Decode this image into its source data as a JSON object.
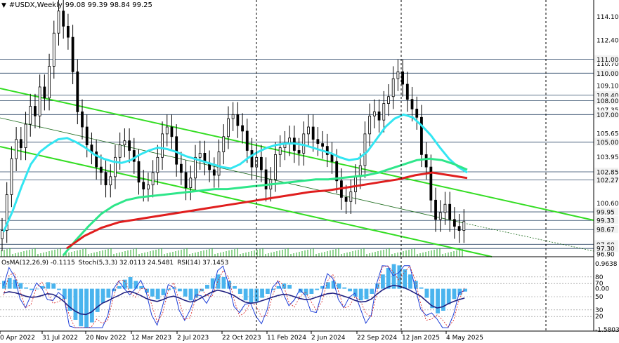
{
  "header": {
    "symbol": "#USDX,Weekly",
    "ohlc": "99.08 99.39 98.84 99.25"
  },
  "osma_header": {
    "osma": "OsMA(12,26,9) -0.1115",
    "stoch": "Stoch(5,3,3) 32.0113 24.5481",
    "rsi": "RSI(14) 37.1453"
  },
  "colors": {
    "ema_short": "#33e6f2",
    "ema_mid": "#2ee68a",
    "ema_long": "#e01e1e",
    "channel": "#33dd22",
    "candle": "#000000",
    "level_line": "#2b4766",
    "histogram": "#4ab4ee",
    "stoch_main": "#1f3fd8",
    "stoch_signal": "#d81f1f",
    "rsi": "#202080",
    "volume": "#22aa22"
  },
  "chart_data": [
    {
      "type": "candlestick",
      "timeframe": "Weekly",
      "x_ticks": [
        "0 Apr 2022",
        "31 Jul 2022",
        "20 Nov 2022",
        "12 Mar 2023",
        "2 Jul 2023",
        "22 Oct 2023",
        "11 Feb 2024",
        "2 Jun 2024",
        "22 Sep 2024",
        "12 Jan 2025",
        "4 May 2025"
      ],
      "y_ticks": [
        114.1,
        112.4,
        110.7,
        109.1,
        107.35,
        105.65,
        103.95,
        102.27,
        100.6,
        99.33,
        98.67,
        96.9
      ],
      "level_labels": [
        111.0,
        110.0,
        108.4,
        108.0,
        107.0,
        105.0,
        102.85,
        102.27,
        99.95,
        99.33,
        98.67,
        97.6,
        97.3
      ],
      "ylim": [
        96.7,
        115.3
      ],
      "close_series": [
        98.6,
        101.2,
        103.8,
        105.2,
        104.6,
        106.3,
        107.6,
        106.9,
        109.0,
        108.2,
        110.5,
        112.9,
        114.5,
        113.4,
        112.6,
        110.1,
        107.2,
        106.1,
        104.8,
        104.3,
        103.2,
        102.8,
        101.9,
        102.5,
        103.9,
        104.8,
        105.1,
        104.4,
        103.6,
        102.1,
        101.6,
        101.9,
        102.8,
        103.9,
        105.6,
        106.1,
        105.4,
        103.4,
        102.8,
        101.7,
        102.4,
        103.9,
        104.2,
        103.5,
        103.0,
        102.6,
        104.3,
        105.4,
        106.7,
        107.0,
        106.2,
        105.8,
        104.4,
        103.2,
        103.9,
        103.0,
        101.6,
        102.3,
        104.1,
        104.6,
        104.9,
        105.3,
        104.4,
        104.2,
        105.6,
        106.1,
        105.2,
        104.9,
        104.7,
        104.1,
        103.6,
        102.2,
        101.0,
        100.7,
        101.4,
        102.5,
        103.3,
        105.6,
        106.9,
        107.2,
        106.6,
        107.8,
        108.3,
        109.6,
        110.1,
        109.2,
        108.1,
        107.4,
        106.8,
        104.1,
        103.2,
        100.8,
        99.4,
        99.9,
        100.5,
        99.4,
        98.9,
        98.6,
        99.25
      ],
      "series": [
        {
          "name": "EMA short",
          "values": [
            98.5,
            100.0,
            101.8,
            103.4,
            104.3,
            104.8,
            105.2,
            105.3,
            105.0,
            104.6,
            104.1,
            103.8,
            103.6,
            103.5,
            103.7,
            104.1,
            104.4,
            104.6,
            104.5,
            104.3,
            104.0,
            103.8,
            103.6,
            103.4,
            103.2,
            103.1,
            103.4,
            103.9,
            104.3,
            104.6,
            104.8,
            104.9,
            104.9,
            104.8,
            104.6,
            104.4,
            104.2,
            103.9,
            103.7,
            103.8,
            104.3,
            105.2,
            106.1,
            106.7,
            107.0,
            106.8,
            106.2,
            105.5,
            104.6,
            103.8,
            103.2,
            102.8
          ]
        },
        {
          "name": "EMA mid",
          "values": [
            96.8,
            97.9,
            98.9,
            99.8,
            100.4,
            100.8,
            101.0,
            101.1,
            101.2,
            101.3,
            101.4,
            101.5,
            101.6,
            101.6,
            101.7,
            101.8,
            101.9,
            102.0,
            102.1,
            102.2,
            102.3,
            102.3,
            102.4,
            102.5,
            102.6,
            102.8,
            103.1,
            103.4,
            103.7,
            103.8,
            103.7,
            103.4,
            103.0
          ]
        },
        {
          "name": "EMA long",
          "values": [
            97.3,
            98.2,
            98.8,
            99.2,
            99.4,
            99.6,
            99.8,
            100.0,
            100.2,
            100.4,
            100.6,
            100.8,
            101.0,
            101.2,
            101.4,
            101.5,
            101.7,
            101.9,
            102.1,
            102.3,
            102.6,
            102.8,
            102.6,
            102.4
          ]
        }
      ],
      "grid": false,
      "legend": "none"
    },
    {
      "type": "bar",
      "title": "OsMA(12,26,9)",
      "y_ticks": [
        0.9638,
        0.0,
        -1.5803
      ],
      "stoch_levels": [
        80,
        70,
        50,
        30,
        20
      ],
      "values": [
        0.3,
        0.42,
        0.35,
        0.22,
        0.05,
        -0.05,
        -0.02,
        0.1,
        0.25,
        0.2,
        -0.05,
        -0.4,
        -0.85,
        -1.2,
        -1.45,
        -1.5,
        -1.3,
        -0.9,
        -0.55,
        -0.35,
        -0.1,
        0.1,
        0.35,
        0.45,
        0.3,
        0.1,
        -0.15,
        -0.3,
        -0.4,
        -0.25,
        -0.05,
        0.05,
        -0.1,
        -0.3,
        -0.45,
        -0.35,
        -0.1,
        0.15,
        0.4,
        0.55,
        0.45,
        0.3,
        0.1,
        -0.2,
        -0.45,
        -0.55,
        -0.5,
        -0.35,
        -0.2,
        -0.05,
        0.1,
        0.2,
        0.15,
        0.0,
        -0.15,
        -0.25,
        -0.2,
        -0.05,
        0.1,
        0.25,
        0.3,
        0.2,
        0.05,
        -0.1,
        -0.3,
        -0.45,
        -0.4,
        -0.2,
        0.2,
        0.55,
        0.8,
        0.95,
        0.9,
        0.75,
        0.55,
        0.3,
        0.05,
        -0.35,
        -0.75,
        -0.95,
        -0.85,
        -0.6,
        -0.4,
        -0.25,
        -0.11
      ]
    }
  ]
}
